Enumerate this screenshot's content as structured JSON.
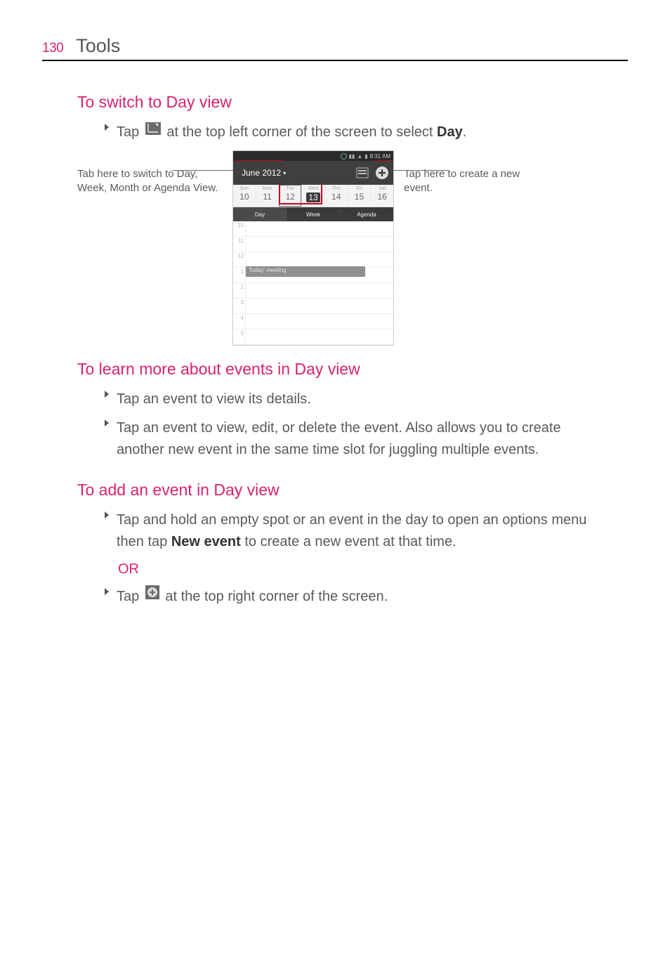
{
  "page": {
    "number": "130",
    "chapter": "Tools"
  },
  "section1": {
    "heading": "To switch to Day view",
    "bullet": {
      "pre": "Tap ",
      "post": " at the top left corner of the screen to select ",
      "bold": "Day",
      "tail": "."
    }
  },
  "callouts": {
    "left": "Tab here to switch to Day, Week, Month or Agenda View.",
    "right": "Tap here to create a new event."
  },
  "phone": {
    "status": {
      "time": "8:31 AM"
    },
    "month_label": "June 2012",
    "days": [
      {
        "dow": "Sun",
        "dom": "10"
      },
      {
        "dow": "Mon",
        "dom": "11"
      },
      {
        "dow": "Tue",
        "dom": "12"
      },
      {
        "dow": "Wed",
        "dom": "13"
      },
      {
        "dow": "Thu",
        "dom": "14"
      },
      {
        "dow": "Fri",
        "dom": "15"
      },
      {
        "dow": "Sat",
        "dom": "16"
      }
    ],
    "tabs": {
      "day": "Day",
      "week": "Week",
      "agenda": "Agenda"
    },
    "hours": [
      "10",
      "11",
      "12",
      "1",
      "2",
      "3",
      "4",
      "5"
    ],
    "event_label": "Today' meeting"
  },
  "section2": {
    "heading": "To learn more about events in Day view",
    "b1": "Tap an event to view its details.",
    "b2": "Tap an event to view, edit, or delete the event. Also allows you to create another new event in the same time slot for juggling multiple events."
  },
  "section3": {
    "heading": "To add an event in Day view",
    "b1_pre": "Tap and hold an empty spot or an event in the day to open an options menu then tap ",
    "b1_bold": "New event",
    "b1_post": " to create a new event at that time.",
    "or": "OR",
    "b2_pre": "Tap ",
    "b2_post": " at the top right corner of the screen."
  }
}
